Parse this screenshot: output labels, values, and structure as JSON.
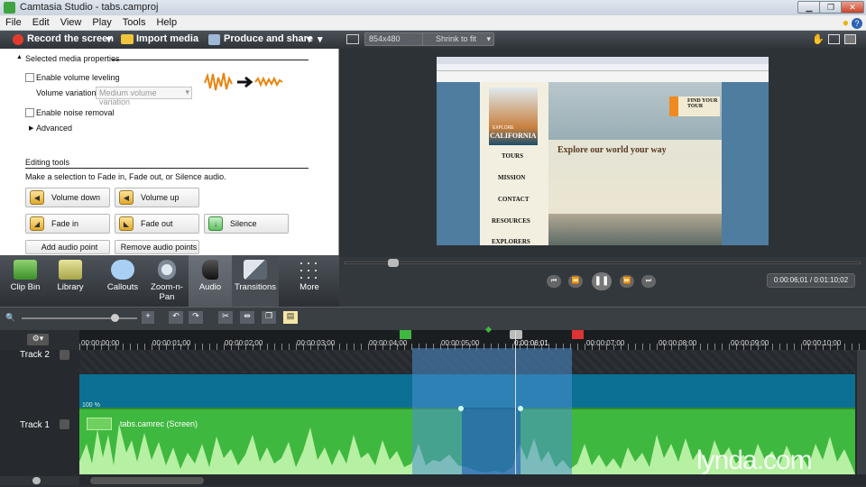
{
  "window": {
    "title": "Camtasia Studio - tabs.camproj"
  },
  "menu": [
    "File",
    "Edit",
    "View",
    "Play",
    "Tools",
    "Help"
  ],
  "toolbar": {
    "record": "Record the screen",
    "import": "Import media",
    "produce": "Produce and share"
  },
  "preview_bar": {
    "dimensions": "854x480",
    "zoom": "Shrink to fit"
  },
  "props": {
    "section": "Selected media properties",
    "volume_leveling": "Enable volume leveling",
    "volume_variation_label": "Volume variation:",
    "volume_variation_value": "Medium volume variation",
    "noise_removal": "Enable noise removal",
    "advanced": "Advanced",
    "editing_tools": "Editing tools",
    "editing_hint": "Make a selection to Fade in, Fade out, or Silence audio.",
    "volume_down": "Volume down",
    "volume_up": "Volume up",
    "fade_in": "Fade in",
    "fade_out": "Fade out",
    "silence": "Silence",
    "add_point": "Add audio point",
    "remove_points": "Remove audio points"
  },
  "tabs": [
    {
      "label": "Clip Bin"
    },
    {
      "label": "Library"
    },
    {
      "label": "Callouts"
    },
    {
      "label": "Zoom-n-\nPan"
    },
    {
      "label": "Audio"
    },
    {
      "label": "Transitions"
    },
    {
      "label": "More"
    }
  ],
  "preview_page": {
    "brand_line": "EXPLORE",
    "brand": "CALIFORNIA",
    "nav": [
      "TOURS",
      "MISSION",
      "CONTACT",
      "RESOURCES",
      "EXPLORERS"
    ],
    "headline": "Explore our world your way",
    "cta": "FIND YOUR TOUR"
  },
  "player": {
    "time": "0:00:06;01 / 0:01:10;02"
  },
  "ruler": {
    "ticks": [
      "00:00:00;00",
      "00:00:01;00",
      "00:00:02;00",
      "00:00:03;00",
      "00:00:04;00",
      "00:00:05;00",
      "0:00:06;01",
      "00:00:07;00",
      "00:00:08;00",
      "00:00:09;00",
      "00:00:10;00"
    ]
  },
  "tracks": {
    "track2": "Track 2",
    "track1": "Track 1",
    "clip": "tabs.camrec (Screen)",
    "volume": "100 %"
  },
  "watermark": "lynda.com",
  "colors": {
    "audio_green": "#3fb83f",
    "clip_blue": "#0c6f94",
    "selection": "#4a90d0",
    "accent_orange": "#ee7a1a"
  }
}
